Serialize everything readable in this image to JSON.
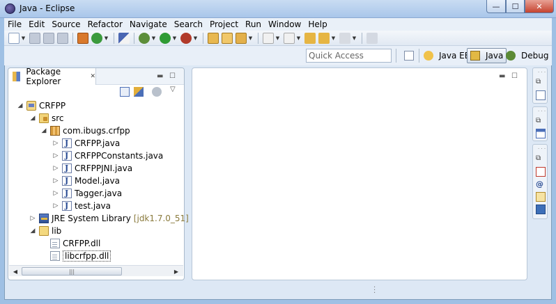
{
  "window": {
    "title": "Java - Eclipse",
    "controls": {
      "minimize": "—",
      "maximize": "☐",
      "close": "✕"
    }
  },
  "menu": [
    "File",
    "Edit",
    "Source",
    "Refactor",
    "Navigate",
    "Search",
    "Project",
    "Run",
    "Window",
    "Help"
  ],
  "toolbar": {
    "icons": [
      "new-icon",
      "save-icon",
      "save-all-icon",
      "print-icon",
      "build-icon",
      "refresh-icon",
      "debug-icon",
      "run-icon",
      "external-tools-icon",
      "new-java-project-icon",
      "open-type-icon",
      "search-icon",
      "next-annotation-icon",
      "prev-annotation-icon",
      "back-icon",
      "forward-icon",
      "pin-editor-icon"
    ]
  },
  "perspectives": {
    "quick_access_placeholder": "Quick Access",
    "items": [
      {
        "label": "Java EE",
        "active": false
      },
      {
        "label": "Java",
        "active": true
      },
      {
        "label": "Debug",
        "active": false
      }
    ]
  },
  "package_explorer": {
    "tab_label": "Package Explorer",
    "close_glyph": "✕",
    "tree": [
      {
        "label": "CRFPP",
        "level": 0,
        "twisty": "◢",
        "icon": "project-icon"
      },
      {
        "label": "src",
        "level": 1,
        "twisty": "◢",
        "icon": "source-folder-icon"
      },
      {
        "label": "com.ibugs.crfpp",
        "level": 2,
        "twisty": "◢",
        "icon": "package-icon"
      },
      {
        "label": "CRFPP.java",
        "level": 3,
        "twisty": "▷",
        "icon": "java-file-icon"
      },
      {
        "label": "CRFPPConstants.java",
        "level": 3,
        "twisty": "▷",
        "icon": "java-file-icon"
      },
      {
        "label": "CRFPPJNI.java",
        "level": 3,
        "twisty": "▷",
        "icon": "java-file-icon"
      },
      {
        "label": "Model.java",
        "level": 3,
        "twisty": "▷",
        "icon": "java-file-icon"
      },
      {
        "label": "Tagger.java",
        "level": 3,
        "twisty": "▷",
        "icon": "java-file-icon"
      },
      {
        "label": "test.java",
        "level": 3,
        "twisty": "▷",
        "icon": "java-file-icon"
      },
      {
        "label": "JRE System Library",
        "decoration": "[jdk1.7.0_51]",
        "level": 1,
        "twisty": "▷",
        "icon": "jre-library-icon"
      },
      {
        "label": "lib",
        "level": 1,
        "twisty": "◢",
        "icon": "folder-icon"
      },
      {
        "label": "CRFPP.dll",
        "level": 2,
        "twisty": "",
        "icon": "file-icon"
      },
      {
        "label": "libcrfpp.dll",
        "level": 2,
        "twisty": "",
        "icon": "file-icon",
        "selected": true
      }
    ],
    "scroll_left": "◀",
    "scroll_right": "▶",
    "scroll_grip": "|||"
  },
  "colors": {
    "accent": "#2a4c94",
    "frame": "#dde8f5",
    "titlebar": "#a9c6ea"
  }
}
